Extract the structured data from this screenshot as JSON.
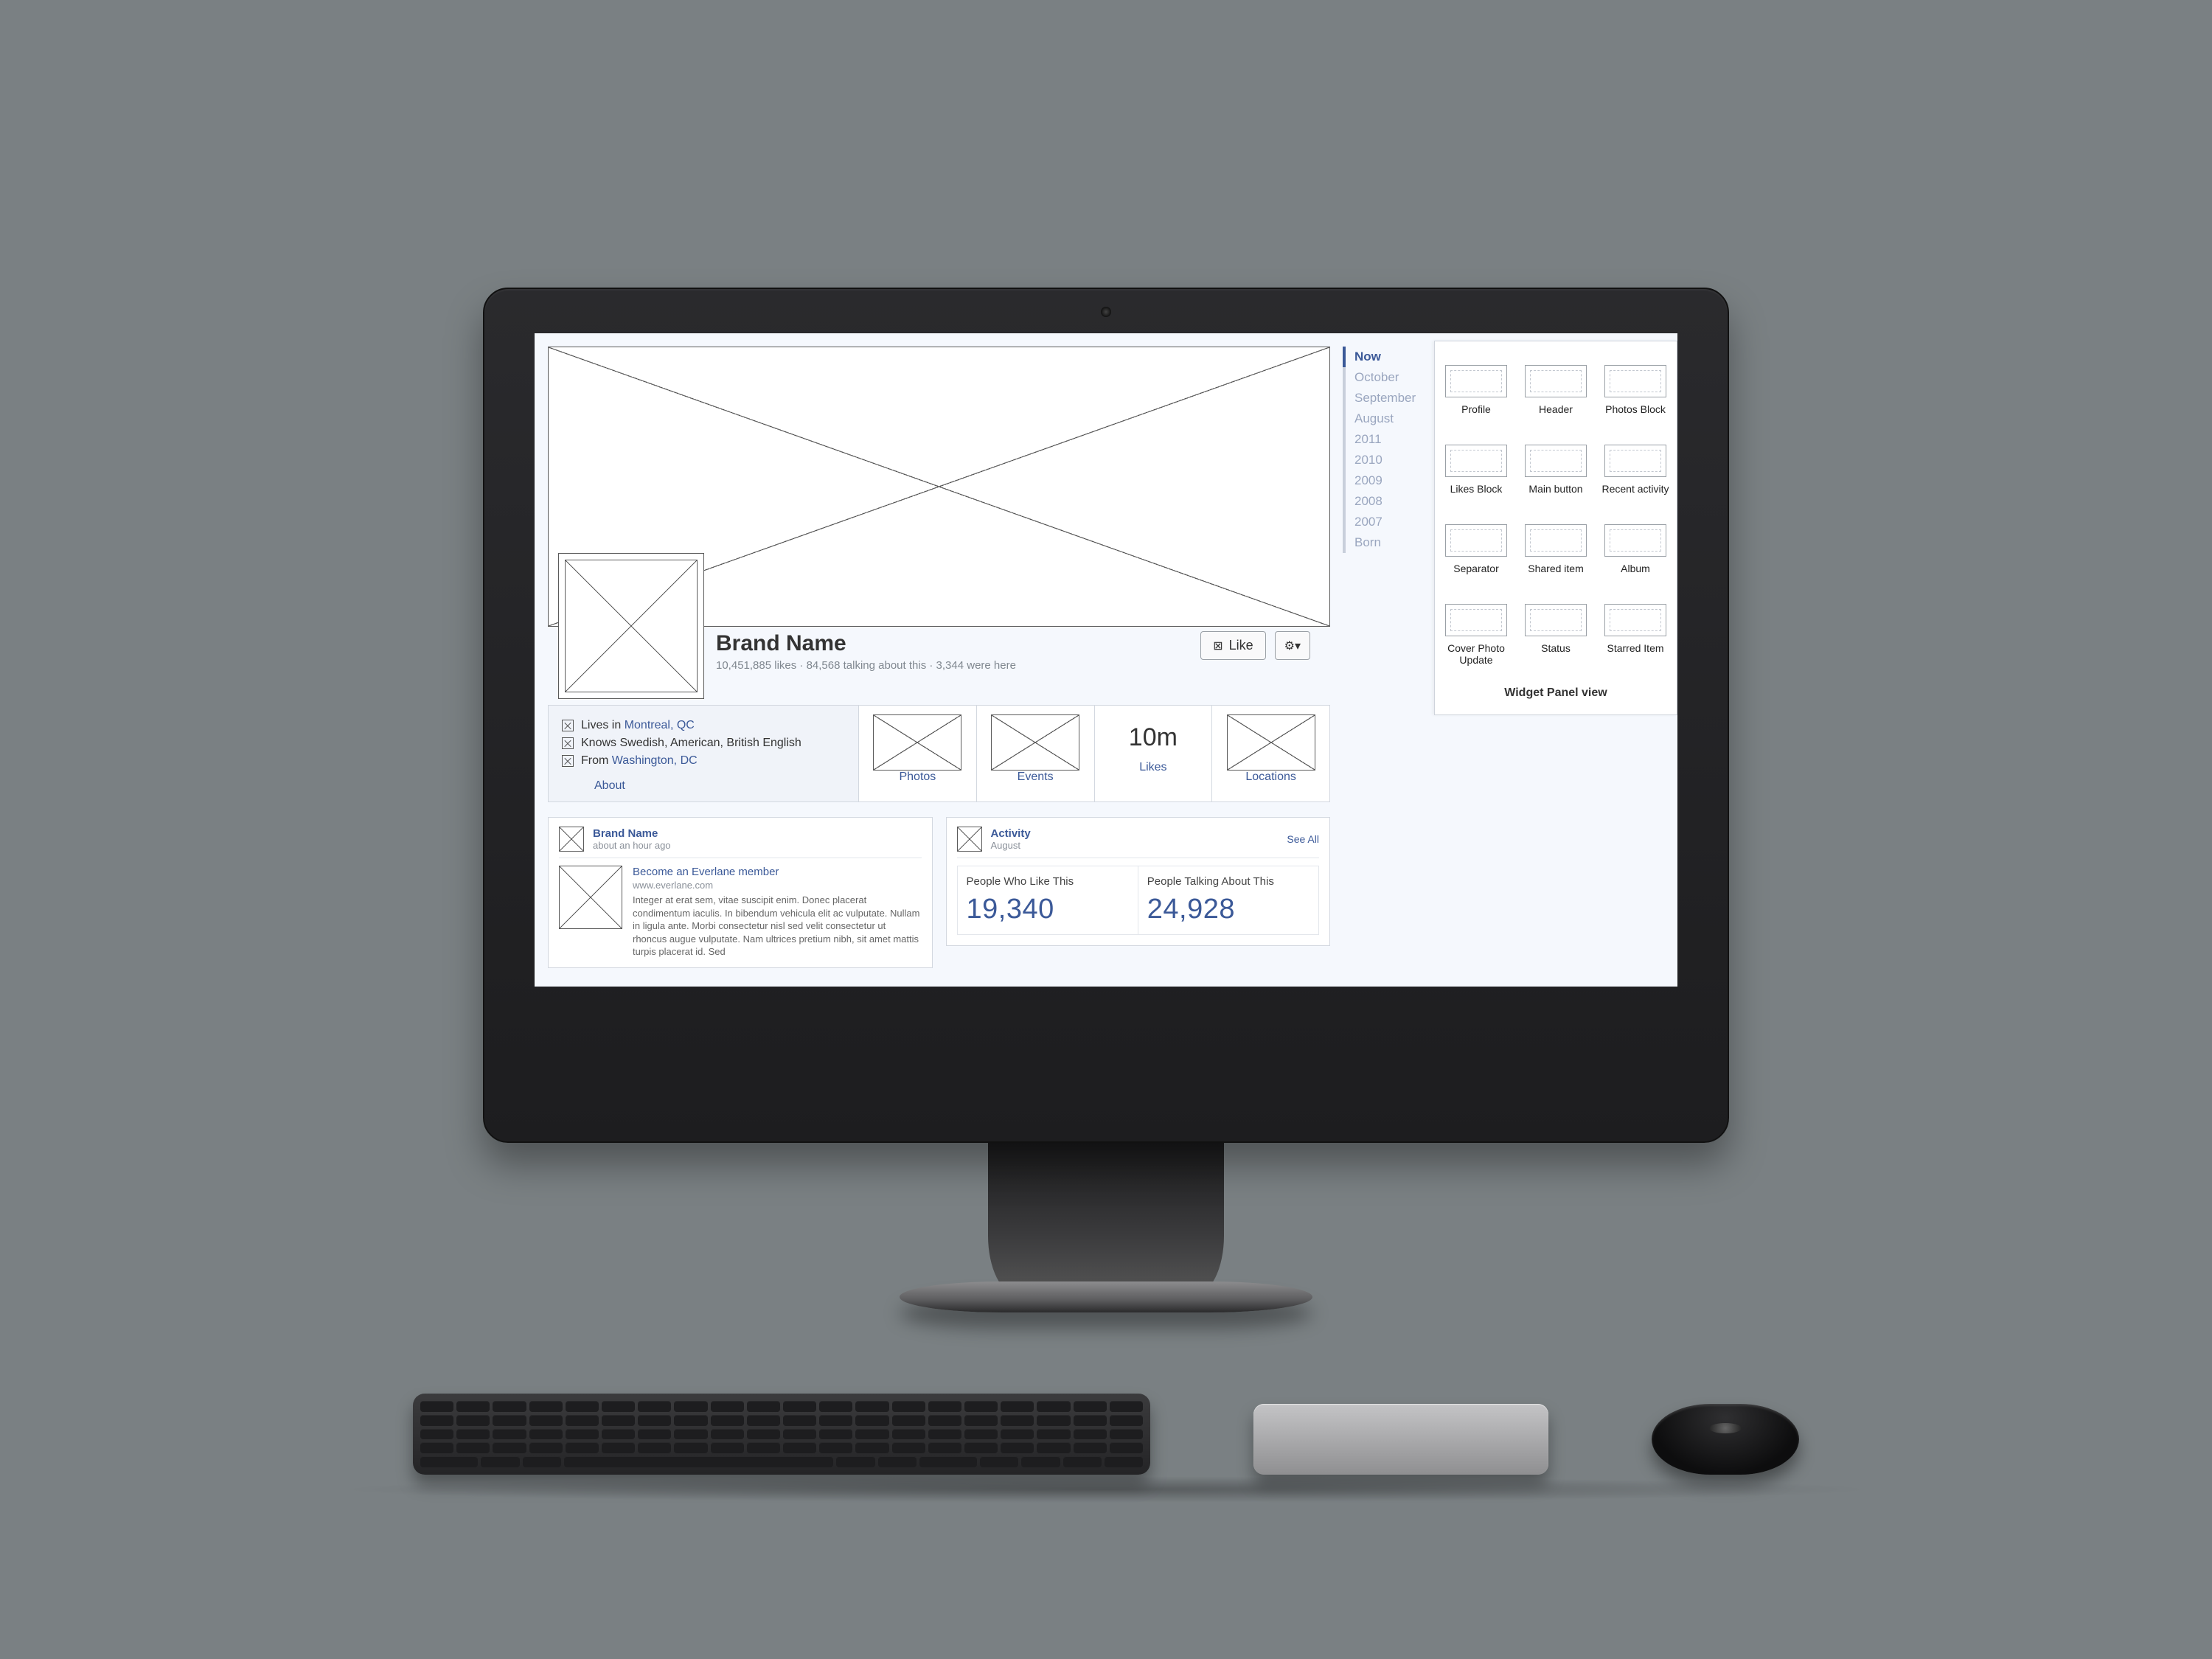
{
  "brand": {
    "name": "Brand Name",
    "stats_line": "10,451,885 likes · 84,568 talking about this · 3,344 were here"
  },
  "actions": {
    "like_label": "Like",
    "gear_glyph": "⚙▾"
  },
  "about": {
    "lives_prefix": "Lives in ",
    "lives_link": "Montreal, QC",
    "knows": "Knows Swedish, American, British English",
    "from_prefix": "From ",
    "from_link": "Washington, DC",
    "about_label": "About"
  },
  "tiles": {
    "likes_value": "10m",
    "labels": {
      "photos": "Photos",
      "events": "Events",
      "likes": "Likes",
      "locations": "Locations"
    }
  },
  "post": {
    "author": "Brand Name",
    "time": "about an hour ago",
    "title": "Become an Everlane member",
    "url": "www.everlane.com",
    "body": "Integer at erat sem, vitae suscipit enim. Donec placerat condimentum iaculis. In bibendum vehicula elit ac vulputate. Nullam in ligula ante. Morbi consectetur nisl sed velit consectetur ut rhoncus augue vulputate. Nam ultrices pretium nibh, sit amet mattis turpis placerat id. Sed"
  },
  "activity": {
    "title": "Activity",
    "month": "August",
    "see_all": "See All",
    "like_label": "People Who Like This",
    "talk_label": "People Talking About This",
    "like_count": "19,340",
    "talk_count": "24,928"
  },
  "timeline": [
    "Now",
    "October",
    "September",
    "August",
    "2011",
    "2010",
    "2009",
    "2008",
    "2007",
    "Born"
  ],
  "widgets": {
    "panel_title": "Widget Panel view",
    "items": [
      "Profile",
      "Header",
      "Photos Block",
      "Likes Block",
      "Main button",
      "Recent activity",
      "Separator",
      "Shared item",
      "Album",
      "Cover Photo Update",
      "Status",
      "Starred Item"
    ]
  }
}
